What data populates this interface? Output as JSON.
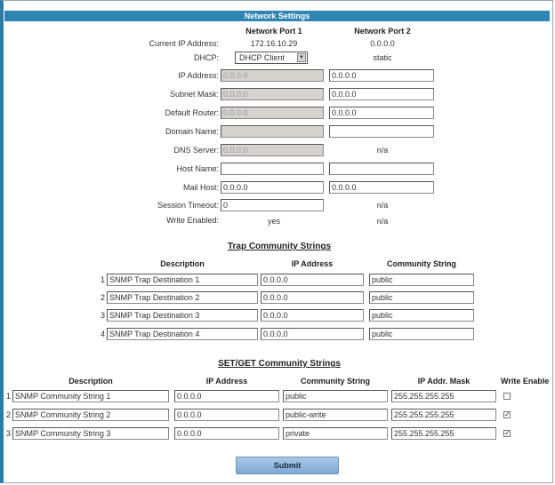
{
  "title": "Network Settings",
  "ports": {
    "port1": "Network Port 1",
    "port2": "Network Port 2"
  },
  "current_ip": {
    "label": "Current IP Address:",
    "port1": "172.16.10.29",
    "port2": "0.0.0.0"
  },
  "dhcp": {
    "label": "DHCP:",
    "port1": "DHCP Client",
    "port2": "static"
  },
  "ip_address": {
    "label": "IP Address:",
    "port1": "0.0.0.0",
    "port2": "0.0.0.0"
  },
  "subnet_mask": {
    "label": "Subnet Mask:",
    "port1": "0.0.0.0",
    "port2": "0.0.0.0"
  },
  "default_router": {
    "label": "Default Router:",
    "port1": "0.0.0.0",
    "port2": "0.0.0.0"
  },
  "domain_name": {
    "label": "Domain Name:",
    "port1": "",
    "port2": ""
  },
  "dns_server": {
    "label": "DNS Server:",
    "port1": "0.0.0.0",
    "port2": "n/a"
  },
  "host_name": {
    "label": "Host Name:",
    "port1": "",
    "port2": ""
  },
  "mail_host": {
    "label": "Mail Host:",
    "port1": "0.0.0.0",
    "port2": "0.0.0.0"
  },
  "session_timeout": {
    "label": "Session Timeout:",
    "port1": "0",
    "port2": "n/a"
  },
  "write_enabled": {
    "label": "Write Enabled:",
    "port1": "yes",
    "port2": "n/a"
  },
  "trap": {
    "heading": "Trap Community Strings",
    "col_description": "Description",
    "col_ip": "IP Address",
    "col_community": "Community String",
    "rows": [
      {
        "num": "1",
        "description": "SNMP Trap Destination 1",
        "ip": "0.0.0.0",
        "community": "public"
      },
      {
        "num": "2",
        "description": "SNMP Trap Destination 2",
        "ip": "0.0.0.0",
        "community": "public"
      },
      {
        "num": "3",
        "description": "SNMP Trap Destination 3",
        "ip": "0.0.0.0",
        "community": "public"
      },
      {
        "num": "4",
        "description": "SNMP Trap Destination 4",
        "ip": "0.0.0.0",
        "community": "public"
      }
    ]
  },
  "setget": {
    "heading": "SET/GET Community Strings",
    "col_description": "Description",
    "col_ip": "IP Address",
    "col_community": "Community String",
    "col_mask": "IP Addr. Mask",
    "col_write": "Write Enable",
    "rows": [
      {
        "num": "1",
        "description": "SNMP Community String 1",
        "ip": "0.0.0.0",
        "community": "public",
        "mask": "255.255.255.255",
        "write_enabled": false
      },
      {
        "num": "2",
        "description": "SNMP Community String 2",
        "ip": "0.0.0.0",
        "community": "public-write",
        "mask": "255.255.255.255",
        "write_enabled": true
      },
      {
        "num": "3",
        "description": "SNMP Community String 3",
        "ip": "0.0.0.0",
        "community": "private",
        "mask": "255.255.255.255",
        "write_enabled": true
      }
    ]
  },
  "submit_label": "Submit"
}
